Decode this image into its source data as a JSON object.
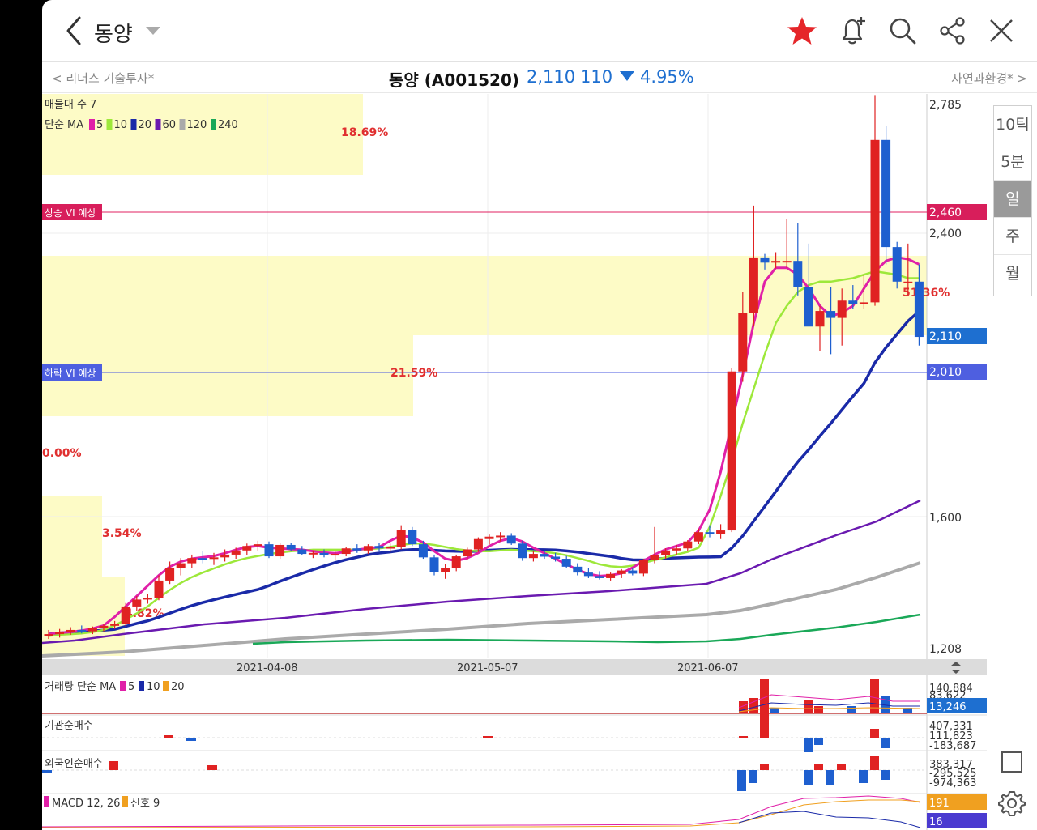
{
  "header": {
    "stock_name": "동양",
    "icons": [
      "back-icon",
      "dropdown-icon",
      "star-icon",
      "alarm-add-icon",
      "search-icon",
      "share-icon",
      "close-icon"
    ],
    "star_color": "#e5262a"
  },
  "subbar": {
    "prev_item": "리더스 기술투자*",
    "title": "동양 (A001520)",
    "price": "2,110",
    "change": "110",
    "change_pct": "4.95%",
    "next_item": "자연과환경*",
    "down_color": "#1e6fd0"
  },
  "chart_labels": {
    "maemul": "매물대 수 7",
    "ma_label": "단순 MA",
    "ma_periods": [
      "5",
      "10",
      "20",
      "60",
      "120",
      "240"
    ],
    "ma_colors": [
      "#e020a8",
      "#9de83a",
      "#1a2aa8",
      "#6a1ab0",
      "#aaaaaa",
      "#1aa858"
    ],
    "vi_up": "상승 VI 예상",
    "vi_down": "하락 VI 예상",
    "pct_labels": [
      "18.69%",
      "51.36%",
      "21.59%",
      "0.00%",
      "3.54%",
      "4.82%"
    ],
    "price_axis": [
      "2,785",
      "2,460",
      "2,400",
      "2,110",
      "2,010",
      "1,600",
      "1,208"
    ],
    "date_axis": [
      "2021-04-08",
      "2021-05-07",
      "2021-06-07"
    ],
    "volume_label": "거래량 단순 MA",
    "volume_ma": [
      "5",
      "10",
      "20"
    ],
    "volume_axis": [
      "140,884",
      "83,622",
      "13,246"
    ],
    "inst_label": "기관순매수",
    "inst_axis": [
      "407,331",
      "111,823",
      "-183,687"
    ],
    "foreign_label": "외국인순매수",
    "foreign_axis": [
      "383,317",
      "-295,525",
      "-974,363"
    ],
    "macd_label": "MACD 12, 26",
    "signal_label": "신호 9",
    "macd_axis": [
      "191",
      "16"
    ]
  },
  "period_tabs": [
    "10틱",
    "5분",
    "일",
    "주",
    "월"
  ],
  "active_period": "일",
  "chart_data": {
    "type": "candlestick",
    "ylim": [
      1208,
      2785
    ],
    "x_ticks": [
      "2021-04-08",
      "2021-05-07",
      "2021-06-07"
    ],
    "last_close": 2110,
    "vi_up": 2460,
    "vi_down": 2010,
    "candles": [
      [
        1245,
        1262,
        1236,
        1250
      ],
      [
        1250,
        1265,
        1240,
        1256
      ],
      [
        1256,
        1270,
        1248,
        1262
      ],
      [
        1262,
        1275,
        1252,
        1258
      ],
      [
        1258,
        1272,
        1250,
        1268
      ],
      [
        1268,
        1280,
        1258,
        1274
      ],
      [
        1274,
        1288,
        1265,
        1280
      ],
      [
        1280,
        1340,
        1272,
        1330
      ],
      [
        1330,
        1360,
        1318,
        1350
      ],
      [
        1350,
        1365,
        1338,
        1355
      ],
      [
        1355,
        1420,
        1348,
        1405
      ],
      [
        1405,
        1460,
        1395,
        1440
      ],
      [
        1440,
        1470,
        1420,
        1455
      ],
      [
        1455,
        1480,
        1440,
        1470
      ],
      [
        1470,
        1490,
        1455,
        1468
      ],
      [
        1468,
        1485,
        1450,
        1472
      ],
      [
        1472,
        1495,
        1460,
        1480
      ],
      [
        1480,
        1500,
        1468,
        1492
      ],
      [
        1492,
        1512,
        1478,
        1505
      ],
      [
        1505,
        1520,
        1490,
        1510
      ],
      [
        1510,
        1518,
        1470,
        1475
      ],
      [
        1475,
        1515,
        1468,
        1508
      ],
      [
        1508,
        1515,
        1490,
        1495
      ],
      [
        1495,
        1505,
        1478,
        1482
      ],
      [
        1482,
        1492,
        1470,
        1485
      ],
      [
        1485,
        1495,
        1472,
        1478
      ],
      [
        1478,
        1490,
        1465,
        1482
      ],
      [
        1482,
        1502,
        1475,
        1498
      ],
      [
        1498,
        1510,
        1485,
        1492
      ],
      [
        1492,
        1510,
        1482,
        1505
      ],
      [
        1505,
        1515,
        1490,
        1498
      ],
      [
        1498,
        1512,
        1488,
        1502
      ],
      [
        1502,
        1565,
        1495,
        1552
      ],
      [
        1552,
        1560,
        1505,
        1510
      ],
      [
        1510,
        1520,
        1468,
        1472
      ],
      [
        1472,
        1480,
        1420,
        1430
      ],
      [
        1430,
        1452,
        1410,
        1440
      ],
      [
        1440,
        1480,
        1432,
        1475
      ],
      [
        1475,
        1500,
        1465,
        1495
      ],
      [
        1495,
        1530,
        1488,
        1525
      ],
      [
        1525,
        1538,
        1510,
        1532
      ],
      [
        1532,
        1545,
        1518,
        1535
      ],
      [
        1535,
        1542,
        1508,
        1512
      ],
      [
        1512,
        1520,
        1462,
        1470
      ],
      [
        1470,
        1490,
        1460,
        1482
      ],
      [
        1482,
        1492,
        1468,
        1474
      ],
      [
        1474,
        1485,
        1460,
        1468
      ],
      [
        1468,
        1476,
        1440,
        1445
      ],
      [
        1445,
        1455,
        1420,
        1428
      ],
      [
        1428,
        1440,
        1412,
        1418
      ],
      [
        1418,
        1432,
        1408,
        1412
      ],
      [
        1412,
        1428,
        1405,
        1424
      ],
      [
        1424,
        1438,
        1412,
        1434
      ],
      [
        1434,
        1442,
        1420,
        1425
      ],
      [
        1425,
        1468,
        1418,
        1464
      ],
      [
        1464,
        1560,
        1455,
        1478
      ],
      [
        1478,
        1498,
        1468,
        1492
      ],
      [
        1492,
        1508,
        1480,
        1498
      ],
      [
        1498,
        1522,
        1490,
        1518
      ],
      [
        1518,
        1555,
        1510,
        1545
      ],
      [
        1545,
        1565,
        1530,
        1540
      ],
      [
        1540,
        1568,
        1525,
        1550
      ],
      [
        1550,
        2020,
        1545,
        2010
      ],
      [
        2010,
        2240,
        1980,
        2180
      ],
      [
        2180,
        2490,
        2140,
        2340
      ],
      [
        2340,
        2350,
        2305,
        2325
      ],
      [
        2325,
        2355,
        2308,
        2330
      ],
      [
        2330,
        2450,
        2310,
        2330
      ],
      [
        2330,
        2440,
        2230,
        2255
      ],
      [
        2255,
        2380,
        2200,
        2140
      ],
      [
        2140,
        2200,
        2070,
        2185
      ],
      [
        2185,
        2255,
        2060,
        2165
      ],
      [
        2165,
        2250,
        2085,
        2215
      ],
      [
        2215,
        2260,
        2190,
        2205
      ],
      [
        2205,
        2290,
        2190,
        2210
      ],
      [
        2210,
        2810,
        2200,
        2680
      ],
      [
        2680,
        2720,
        2320,
        2370
      ],
      [
        2370,
        2385,
        2250,
        2270
      ],
      [
        2270,
        2380,
        2240,
        2270
      ],
      [
        2270,
        2320,
        2085,
        2110
      ]
    ],
    "ma_series": {
      "5": [
        1250,
        1254,
        1256,
        1260,
        1266,
        1275,
        1300,
        1330,
        1360,
        1390,
        1420,
        1445,
        1460,
        1468,
        1472,
        1476,
        1484,
        1494,
        1502,
        1505,
        1500,
        1498,
        1496,
        1494,
        1490,
        1486,
        1484,
        1488,
        1494,
        1498,
        1502,
        1520,
        1535,
        1530,
        1515,
        1490,
        1468,
        1462,
        1470,
        1485,
        1505,
        1520,
        1528,
        1518,
        1500,
        1484,
        1468,
        1452,
        1436,
        1424,
        1418,
        1420,
        1426,
        1442,
        1462,
        1480,
        1495,
        1505,
        1515,
        1550,
        1610,
        1720,
        1860,
        2000,
        2150,
        2270,
        2310,
        2310,
        2290,
        2250,
        2200,
        2170,
        2180,
        2200,
        2250,
        2300,
        2330,
        2340,
        2335,
        2320
      ],
      "10": [
        1245,
        1248,
        1250,
        1252,
        1256,
        1262,
        1275,
        1292,
        1310,
        1330,
        1355,
        1378,
        1398,
        1415,
        1428,
        1440,
        1452,
        1462,
        1470,
        1476,
        1482,
        1486,
        1490,
        1492,
        1494,
        1494,
        1494,
        1494,
        1494,
        1496,
        1498,
        1502,
        1508,
        1512,
        1512,
        1508,
        1502,
        1496,
        1492,
        1490,
        1490,
        1492,
        1494,
        1492,
        1490,
        1488,
        1484,
        1478,
        1470,
        1462,
        1452,
        1446,
        1444,
        1448,
        1456,
        1464,
        1472,
        1480,
        1488,
        1500,
        1560,
        1650,
        1750,
        1860,
        1960,
        2060,
        2150,
        2200,
        2240,
        2260,
        2270,
        2270,
        2275,
        2280,
        2290,
        2300,
        2295,
        2290,
        2280,
        2280
      ]
    }
  }
}
